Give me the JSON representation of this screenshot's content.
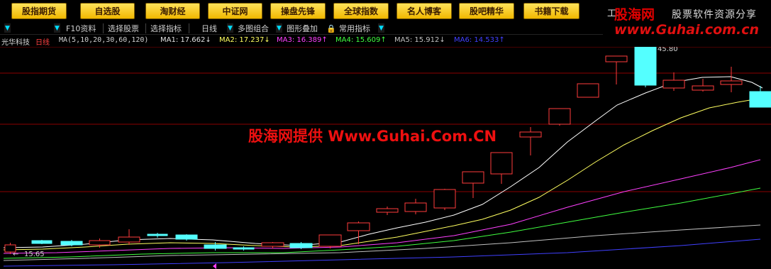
{
  "topbar": {
    "buttons": [
      "股指期货",
      "自选股",
      "淘财经",
      "中证网",
      "操盘先锋",
      "全球指数",
      "名人博客",
      "股吧精华",
      "书籍下载"
    ],
    "corner_text": "工"
  },
  "logo": {
    "title": "股海网",
    "slogan": "股票软件资源分享",
    "url": "www.Guhai.com.cn"
  },
  "toolbar": {
    "items": [
      "F10资料",
      "选择股票",
      "选择指标",
      "日线",
      "多图组合",
      "图形叠加",
      "常用指标"
    ]
  },
  "legend": {
    "stock_name": "光华科技",
    "period": "日线",
    "ma_def": "MA(5,10,20,30,60,120)",
    "ma1": "MA1: 17.662↓",
    "ma2": "MA2: 17.237↓",
    "ma3": "MA3: 16.389↑",
    "ma4": "MA4: 15.609↑",
    "ma5": "MA5: 15.912↓",
    "ma6": "MA6: 14.533↑"
  },
  "chart": {
    "high_label": "45.80",
    "low_label": "15.65",
    "watermark": "股海网提供 Www.Guhai.Com.CN",
    "colors": {
      "up": "#ff3c3c",
      "down": "#54ffff",
      "ma1": "#ffffff",
      "ma2": "#ffff60",
      "ma3": "#ff40ff",
      "ma4": "#40ff40",
      "ma5": "#c0c0c0",
      "ma6": "#4040ff",
      "grid": "#8b0000"
    }
  }
}
